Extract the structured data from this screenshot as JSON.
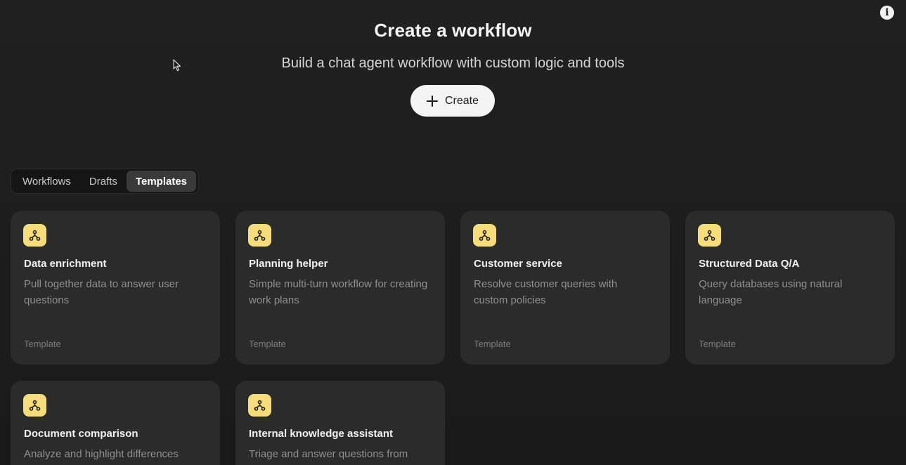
{
  "header": {
    "title": "Create a workflow",
    "subtitle": "Build a chat agent workflow with custom logic and tools",
    "create_label": "Create",
    "info_icon": "info-icon"
  },
  "tabs": [
    {
      "label": "Workflows",
      "active": false
    },
    {
      "label": "Drafts",
      "active": false
    },
    {
      "label": "Templates",
      "active": true
    }
  ],
  "cards": [
    {
      "title": "Data enrichment",
      "description": "Pull together data to answer user questions",
      "tag": "Template",
      "icon": "workflow-icon"
    },
    {
      "title": "Planning helper",
      "description": "Simple multi-turn workflow for creating work plans",
      "tag": "Template",
      "icon": "workflow-icon"
    },
    {
      "title": "Customer service",
      "description": "Resolve customer queries with custom policies",
      "tag": "Template",
      "icon": "workflow-icon"
    },
    {
      "title": "Structured Data Q/A",
      "description": "Query databases using natural language",
      "tag": "Template",
      "icon": "workflow-icon"
    },
    {
      "title": "Document comparison",
      "description": "Analyze and highlight differences",
      "tag": "",
      "icon": "workflow-icon"
    },
    {
      "title": "Internal knowledge assistant",
      "description": "Triage and answer questions from",
      "tag": "",
      "icon": "workflow-icon"
    }
  ],
  "colors": {
    "background": "#1c1c1c",
    "card": "#2b2b2b",
    "icon_accent": "#f6dc7a",
    "button": "#f4f4f4"
  }
}
